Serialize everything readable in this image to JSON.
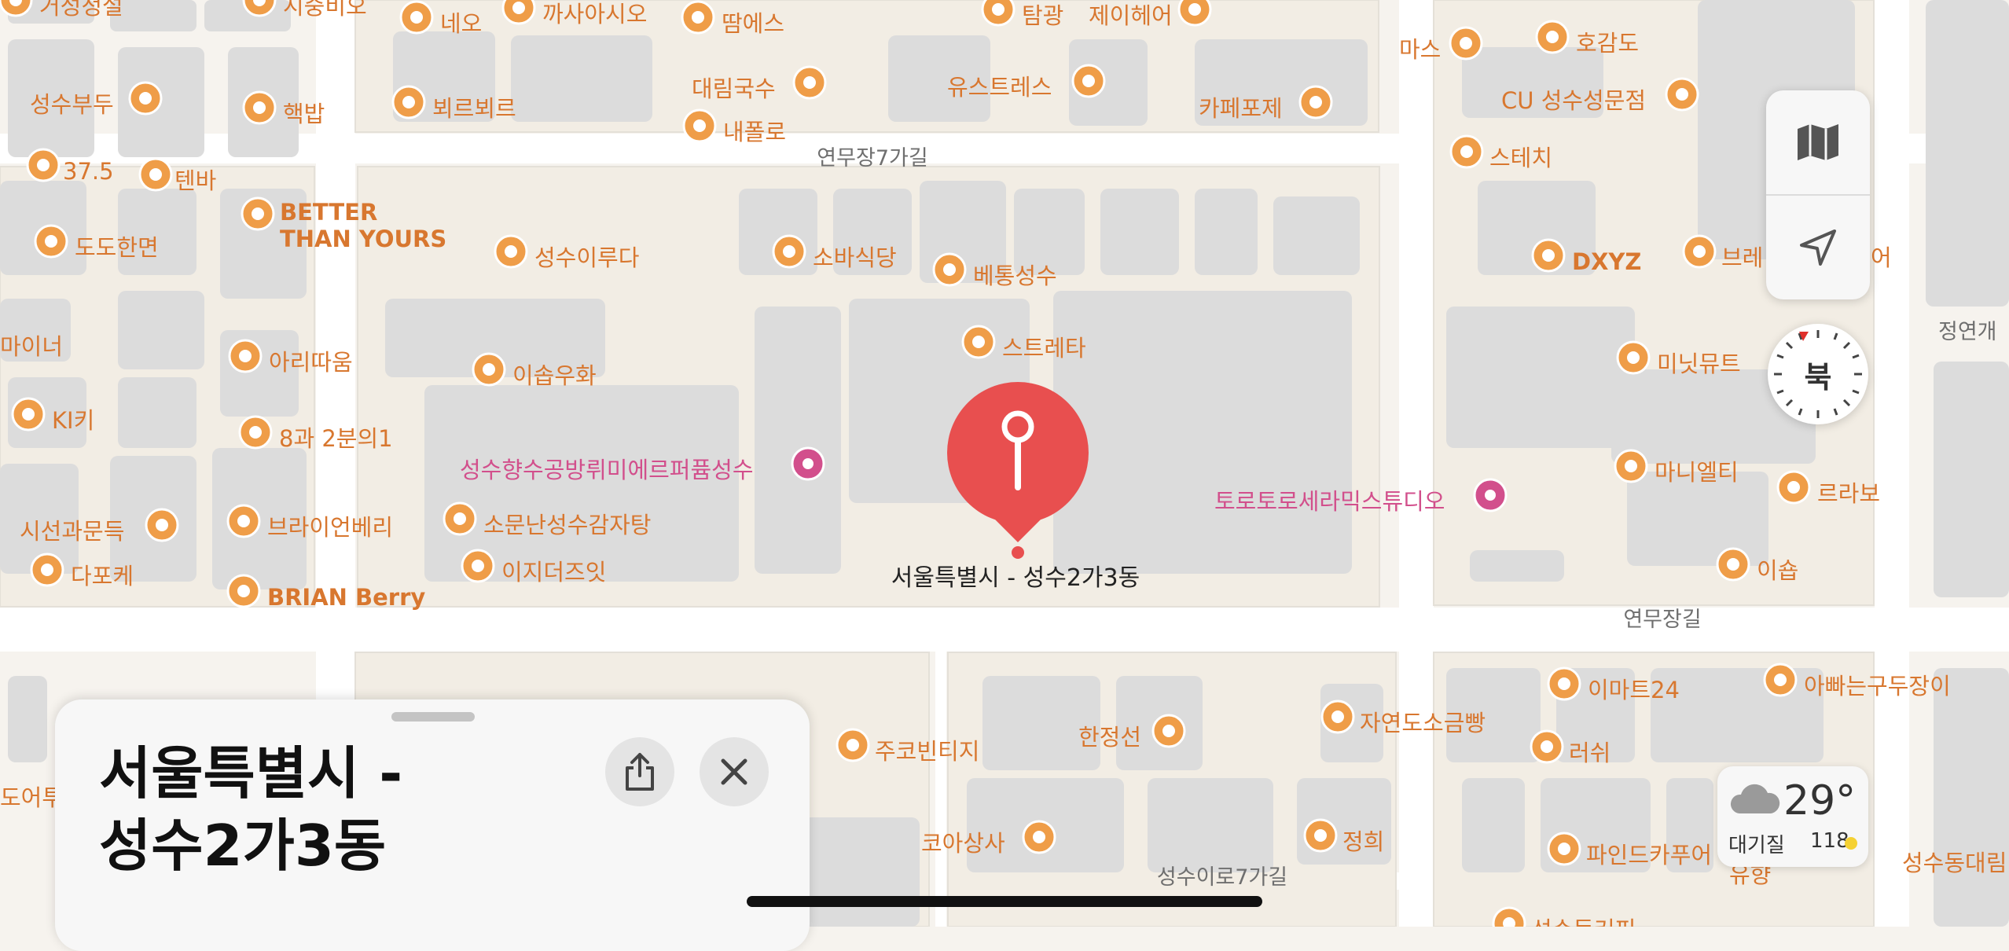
{
  "pois": [
    {
      "text": "거성정설",
      "icon": "fork-knife-icon",
      "kind": "food"
    },
    {
      "text": "시중비오",
      "icon": "fork-knife-icon",
      "kind": "food"
    },
    {
      "text": "네오",
      "icon": "shirt-icon",
      "kind": "shop"
    },
    {
      "text": "까사아시오",
      "icon": "fork-knife-icon",
      "kind": "food"
    },
    {
      "text": "땀에스",
      "icon": "shirt-icon",
      "kind": "shop"
    },
    {
      "text": "탐광",
      "icon": "fork-knife-icon",
      "kind": "food"
    },
    {
      "text": "제이헤어",
      "icon": "scissors-icon",
      "kind": "shop"
    },
    {
      "text": "마스",
      "icon": "cocktail-icon",
      "kind": "bar"
    },
    {
      "text": "호감도",
      "icon": "fork-knife-icon",
      "kind": "food"
    },
    {
      "text": "성수부두",
      "icon": "shrimp-icon",
      "kind": "food"
    },
    {
      "text": "핵밥",
      "icon": "fork-knife-icon",
      "kind": "food"
    },
    {
      "text": "뵈르뵈르",
      "icon": "cart-icon",
      "kind": "shop"
    },
    {
      "text": "대림국수",
      "icon": "fork-knife-icon",
      "kind": "food"
    },
    {
      "text": "내폴로",
      "icon": "fork-knife-icon",
      "kind": "food"
    },
    {
      "text": "유스트레스",
      "icon": "cup-icon",
      "kind": "cafe"
    },
    {
      "text": "카페포제",
      "icon": "cup-icon",
      "kind": "cafe"
    },
    {
      "text": "CU 성수성문점",
      "icon": "store-icon",
      "kind": "shop"
    },
    {
      "text": "37.5",
      "icon": "cup-icon",
      "kind": "cafe"
    },
    {
      "text": "텐바",
      "icon": "cocktail-icon",
      "kind": "bar"
    },
    {
      "text": "스테치",
      "icon": "cup-icon",
      "kind": "cafe"
    },
    {
      "text": "BETTER",
      "icon": "cup-icon",
      "kind": "cafe",
      "bold": true
    },
    {
      "text": "THAN YOURS",
      "icon": "",
      "kind": "cafe",
      "bold": true
    },
    {
      "text": "도도한면",
      "icon": "bowl-icon",
      "kind": "food"
    },
    {
      "text": "성수이루다",
      "icon": "fork-knife-icon",
      "kind": "food"
    },
    {
      "text": "소바식당",
      "icon": "fork-knife-icon",
      "kind": "food"
    },
    {
      "text": "베통성수",
      "icon": "cup-icon",
      "kind": "cafe"
    },
    {
      "text": "DXYZ",
      "icon": "cocktail-icon",
      "kind": "bar",
      "bold": true
    },
    {
      "text": "브레",
      "icon": "monitor-icon",
      "kind": "shop"
    },
    {
      "text": "어",
      "icon": "",
      "kind": "shop"
    },
    {
      "text": "마이너",
      "icon": "",
      "kind": "food"
    },
    {
      "text": "아리따움",
      "icon": "lipstick-icon",
      "kind": "shop"
    },
    {
      "text": "스트레타",
      "icon": "lamp-icon",
      "kind": "shop"
    },
    {
      "text": "이솝우화",
      "icon": "fork-knife-icon",
      "kind": "food"
    },
    {
      "text": "미닛뮤트",
      "icon": "bag-icon",
      "kind": "shop"
    },
    {
      "text": "KI키",
      "icon": "cocktail-icon",
      "kind": "bar"
    },
    {
      "text": "8과 2분의1",
      "icon": "cup-icon",
      "kind": "cafe"
    },
    {
      "text": "성수향수공방뤼미에르퍼퓸성수",
      "icon": "pink-dot-icon",
      "kind": "pink"
    },
    {
      "text": "마니엘티",
      "icon": "shirt-icon",
      "kind": "shop"
    },
    {
      "text": "르라보",
      "icon": "bag-icon",
      "kind": "shop"
    },
    {
      "text": "토로토로세라믹스튜디오",
      "icon": "pink-dot-icon",
      "kind": "pink"
    },
    {
      "text": "시선과문득",
      "icon": "shirt-icon",
      "kind": "shop"
    },
    {
      "text": "브라이언베리",
      "icon": "shirt-icon",
      "kind": "shop"
    },
    {
      "text": "소문난성수감자탕",
      "icon": "fork-knife-icon",
      "kind": "food"
    },
    {
      "text": "이숍",
      "icon": "lipstick-icon",
      "kind": "shop"
    },
    {
      "text": "다포케",
      "icon": "fork-knife-icon",
      "kind": "food"
    },
    {
      "text": "이지더즈잇",
      "icon": "cocktail-icon",
      "kind": "bar"
    },
    {
      "text": "BRIAN Berry",
      "icon": "shirt-icon",
      "kind": "shop",
      "bold": true
    },
    {
      "text": "이마트24",
      "icon": "store-icon",
      "kind": "shop"
    },
    {
      "text": "아빠는구두장이",
      "icon": "shoe-icon",
      "kind": "shop"
    },
    {
      "text": "자연도소금빵",
      "icon": "croissant-icon",
      "kind": "food"
    },
    {
      "text": "한정선",
      "icon": "croissant-icon",
      "kind": "food"
    },
    {
      "text": "주코빈티지",
      "icon": "shirt-icon",
      "kind": "shop"
    },
    {
      "text": "러쉬",
      "icon": "lipstick-icon",
      "kind": "shop"
    },
    {
      "text": "도어투",
      "icon": "",
      "kind": "shop"
    },
    {
      "text": "파인드카푸어",
      "icon": "bag-icon",
      "kind": "shop"
    },
    {
      "text": "정희",
      "icon": "scissors-icon",
      "kind": "shop"
    },
    {
      "text": "코아상사",
      "icon": "shirt-icon",
      "kind": "shop"
    },
    {
      "text": "성수동대림",
      "icon": "",
      "kind": "food"
    },
    {
      "text": "유향",
      "icon": "",
      "kind": "food"
    },
    {
      "text": "성수동커피",
      "icon": "cup-icon",
      "kind": "cafe"
    }
  ],
  "streets": {
    "s1": "연무장7가길",
    "s2": "연무장길",
    "s3": "성수이로7가길",
    "s4": "정연개"
  },
  "pin": {
    "label": "서울특별시 - 성수2가3동",
    "color": "#e84f4f"
  },
  "controls": {
    "map_icon": "map-icon",
    "location_icon": "location-arrow-icon"
  },
  "compass": {
    "label": "북",
    "icon": "compass-icon"
  },
  "weather": {
    "temperature": "29°",
    "aqi_label": "대기질",
    "aqi_value": "118",
    "icon": "cloud-icon",
    "aqi_color": "#f5d133"
  },
  "sheet": {
    "title_line1": "서울특별시 -",
    "title_line2": "성수2가3동",
    "share_icon": "share-icon",
    "close_icon": "close-icon"
  },
  "colors": {
    "poi": "#d8772f",
    "poi_icon_bg": "#ef9d48",
    "pink": "#d24f8c",
    "pin": "#e84f4f",
    "ground": "#f6f3ee",
    "building": "#dcdcdc",
    "road": "#ffffff"
  }
}
